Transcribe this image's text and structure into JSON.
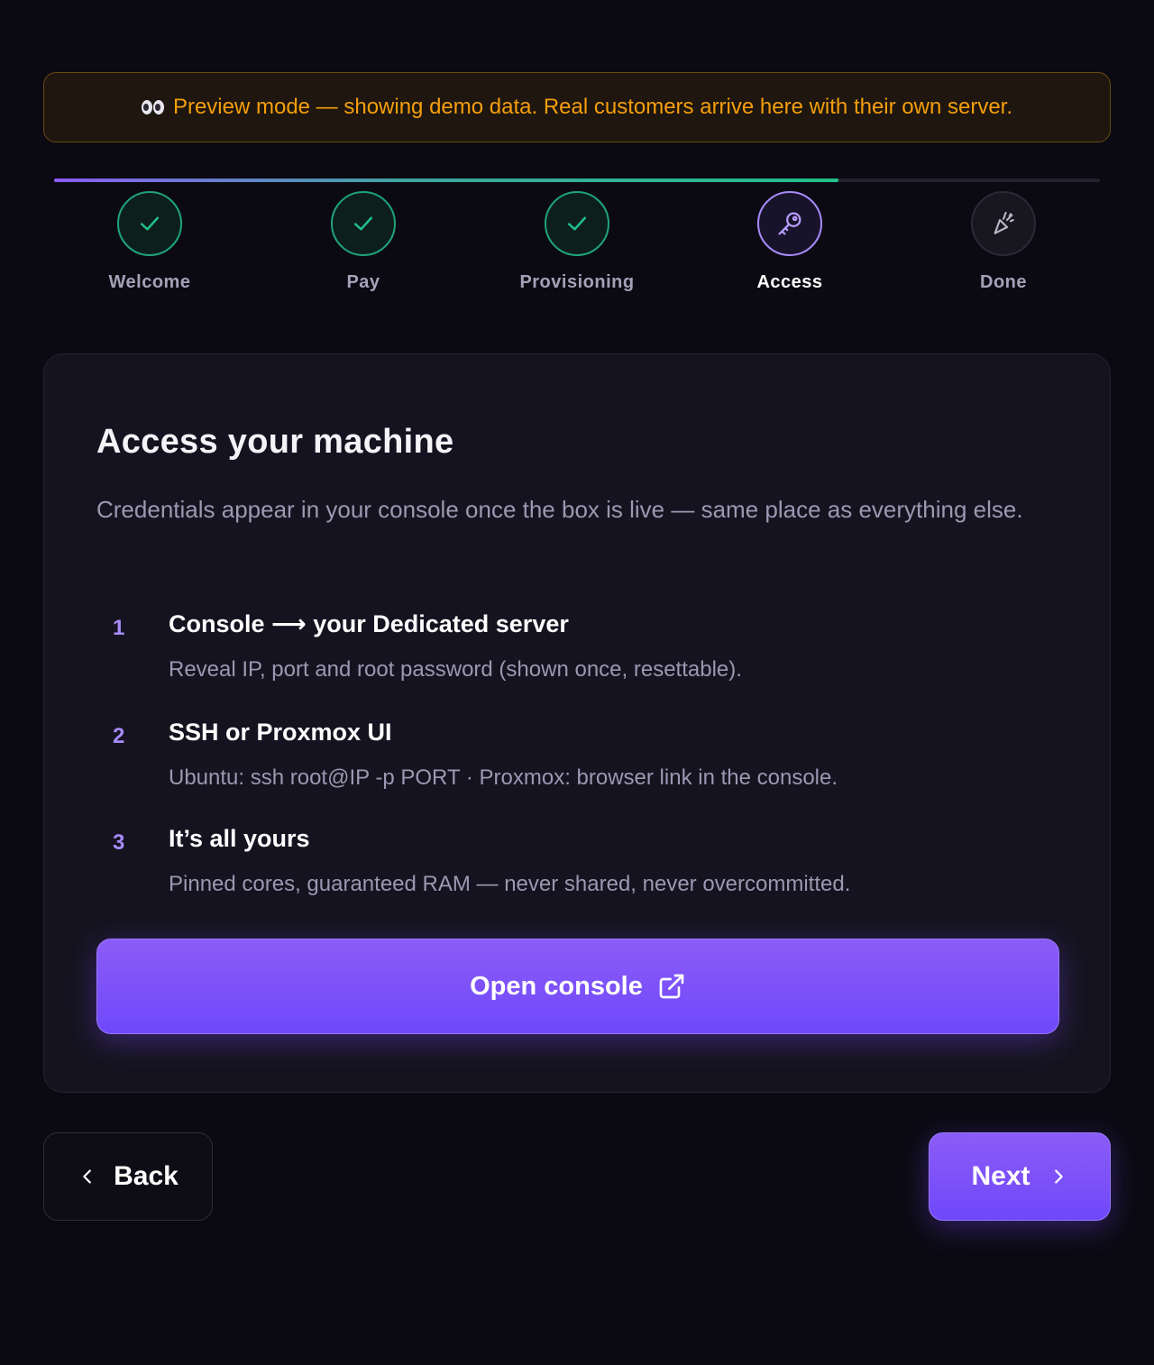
{
  "banner": {
    "icon": "eyes-icon",
    "text": "Preview mode — showing demo data. Real customers arrive here with their own server."
  },
  "stepper": {
    "progress": 0.75,
    "steps": [
      {
        "label": "Welcome",
        "state": "done",
        "icon": "check-icon"
      },
      {
        "label": "Pay",
        "state": "done",
        "icon": "check-icon"
      },
      {
        "label": "Provisioning",
        "state": "done",
        "icon": "check-icon"
      },
      {
        "label": "Access",
        "state": "current",
        "icon": "key-icon"
      },
      {
        "label": "Done",
        "state": "pending",
        "icon": "party-popper-icon"
      }
    ]
  },
  "card": {
    "title": "Access your machine",
    "description": "Credentials appear in your console once the box is live — same place as everything else.",
    "items": [
      {
        "number": "1",
        "heading": "Console ⟶ your Dedicated server",
        "text": "Reveal IP, port and root password (shown once, resettable)."
      },
      {
        "number": "2",
        "heading": "SSH or Proxmox UI",
        "text": "Ubuntu: ssh root@IP -p PORT · Proxmox: browser link in the console."
      },
      {
        "number": "3",
        "heading": "It’s all yours",
        "text": "Pinned cores, guaranteed RAM — never shared, never overcommitted."
      }
    ],
    "button_label": "Open console",
    "button_icon": "external-link-icon"
  },
  "nav": {
    "back_label": "Back",
    "next_label": "Next"
  },
  "colors": {
    "background": "#0b0a12",
    "accent": "#8b5cf6",
    "success": "#22c08a",
    "warning": "#f59e0b"
  }
}
